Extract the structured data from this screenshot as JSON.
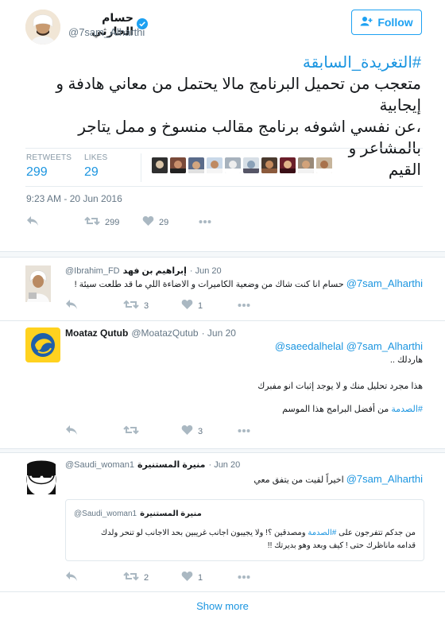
{
  "tweet": {
    "author_name": "حسام الحارثي",
    "author_handle": "@7sam_Alharthi",
    "follow_label": "Follow",
    "hashtag": "#التغريدة_السابقة",
    "text_line1": "متعجب من تحميل البرنامج مالا يحتمل من معاني هادفة و إيجابية",
    "text_line2": "،عن نفسي اشوفه برنامج مقالب منسوخ و ممل يتاجر بالمشاعر و",
    "text_line3": "القيم",
    "retweets_label": "RETWEETS",
    "retweets_count": "299",
    "likes_label": "LIKES",
    "likes_count": "29",
    "timestamp": "9:23 AM - 20 Jun 2016",
    "action_retweets": "299",
    "action_likes": "29"
  },
  "replies": [
    {
      "name": "إبراهيم بن فهد",
      "handle": "@Ibrahim_FD",
      "date": "· Jun 20",
      "mention": "@7sam_Alharthi",
      "text": "حسام انا كنت شاك من وضعية الكاميرات و الاضاءة اللي ما قد طلعت سيئة !",
      "retweets": "3",
      "likes": "1"
    },
    {
      "name": "Moataz Qutub",
      "handle": "@MoatazQutub",
      "date": "· Jun 20",
      "mention": "@saeedalhelal @7sam_Alharthi",
      "line1": "هاردلك ..",
      "line2": "هذا مجرد تحليل منك و لا يوجد إثبات انو مفبرك",
      "hashtag": "#الصدمة",
      "line3": "من أفضل البرامج هذا الموسم",
      "likes": "3"
    },
    {
      "name": "منيرة المستنيرة",
      "handle": "@Saudi_woman1",
      "date": "· Jun 20",
      "mention": "@7sam_Alharthi",
      "text": "اخيراً لقيت من يتفق معي",
      "quote": {
        "name": "منيرة المستنيرة",
        "handle": "@Saudi_woman1",
        "line1_pre": "من جدكم تتفرجون على",
        "line1_tag": "#الصدمة",
        "line1_post": "ومصدقين ؟! ولا يجيبون اجانب غريبين بحد الاجانب لو تنحر ولدك",
        "line2": "قدامه ماناظرك حتى ! كيف وبعد وهو بديرتك !!"
      },
      "retweets": "2",
      "likes": "1"
    }
  ],
  "show_more": "Show more",
  "colors": {
    "accent": "#1b95e0",
    "follow": "#1da1f2",
    "divider": "#e1e8ed",
    "muted": "#657786"
  },
  "icons": [
    "verified-badge-icon",
    "add-user-icon",
    "reply-icon",
    "retweet-icon",
    "heart-icon",
    "more-icon"
  ]
}
